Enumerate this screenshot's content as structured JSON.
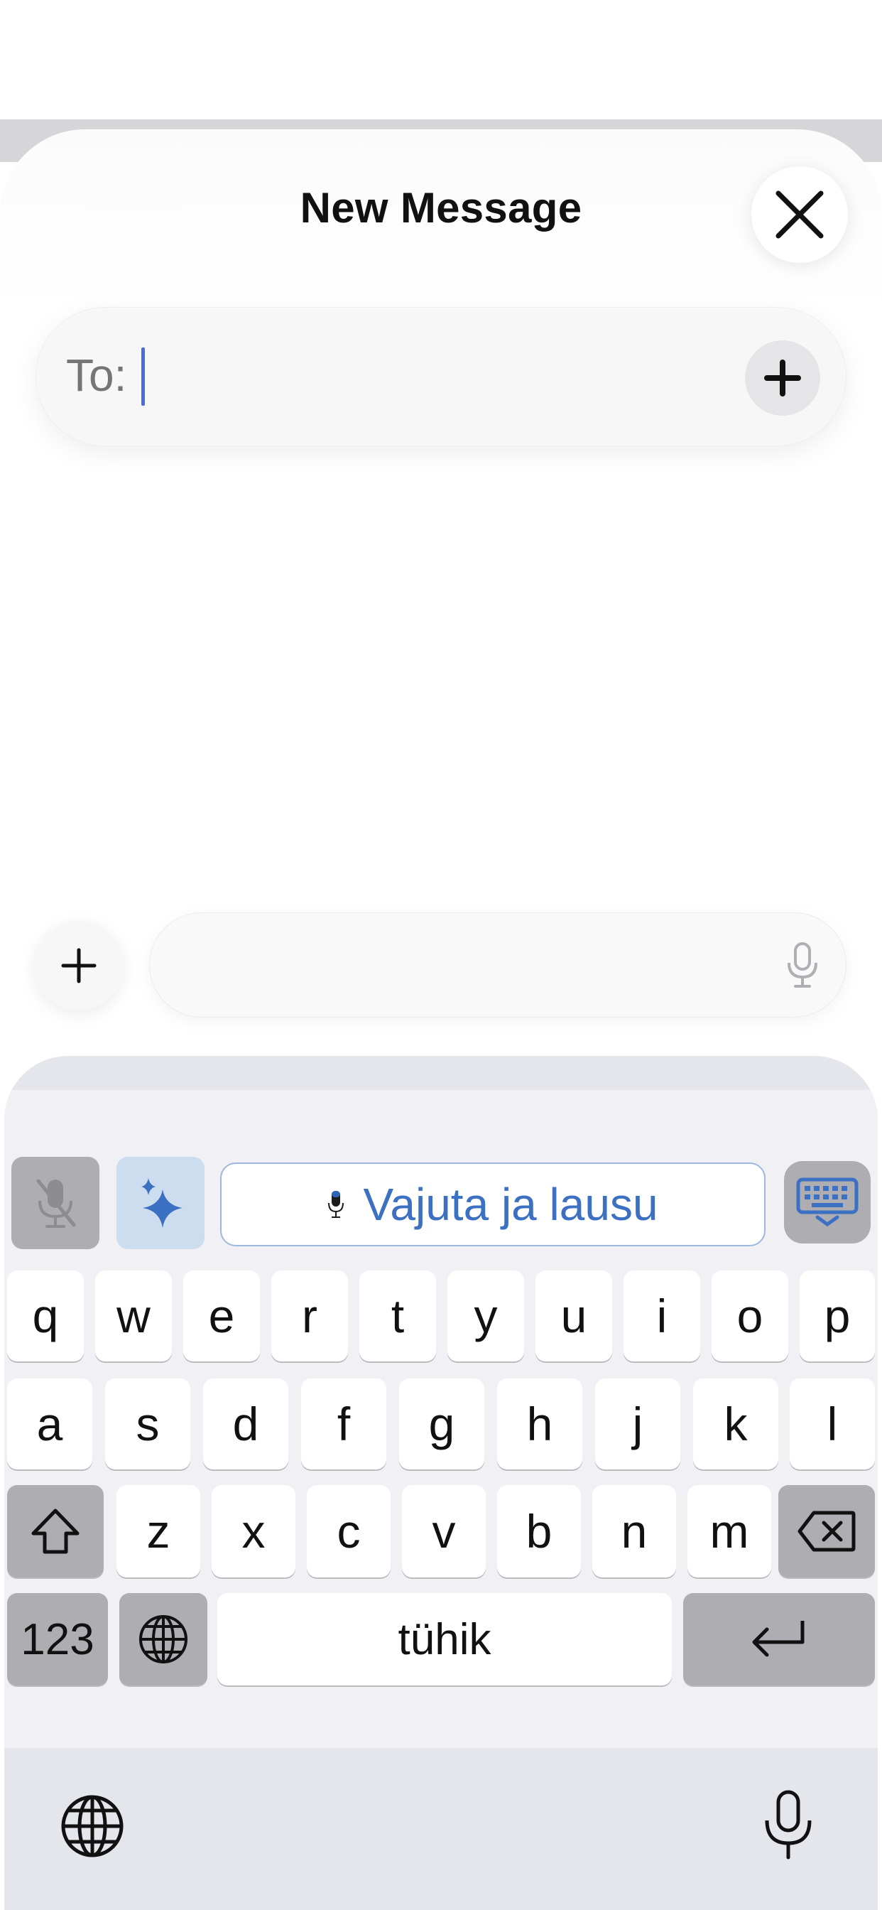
{
  "header": {
    "title": "New Message"
  },
  "to_field": {
    "label": "To:"
  },
  "keyboard": {
    "dictation_label": "Vajuta ja lausu",
    "row1": [
      "q",
      "w",
      "e",
      "r",
      "t",
      "y",
      "u",
      "i",
      "o",
      "p"
    ],
    "row2": [
      "a",
      "s",
      "d",
      "f",
      "g",
      "h",
      "j",
      "k",
      "l"
    ],
    "row3": [
      "z",
      "x",
      "c",
      "v",
      "b",
      "n",
      "m"
    ],
    "numbers_label": "123",
    "space_label": "tühik"
  },
  "icons": [
    "close-icon",
    "plus-icon",
    "microphone-icon",
    "mic-off-icon",
    "sparkle-icon",
    "keyboard-icon",
    "shift-icon",
    "backspace-icon",
    "globe-icon",
    "return-icon"
  ],
  "colors": {
    "accent": "#3c70c2",
    "caret": "#4a6ed8",
    "keyboard_bg": "#f1f1f5"
  }
}
